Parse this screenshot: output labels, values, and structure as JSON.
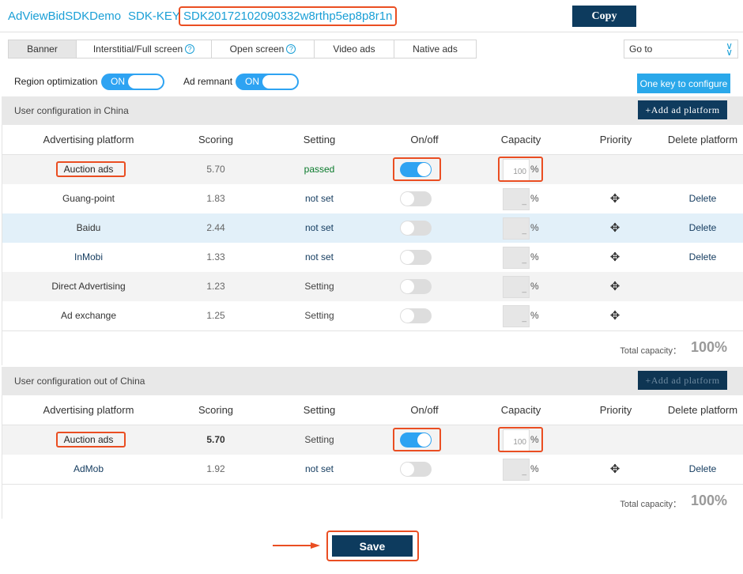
{
  "header": {
    "app_title": "AdViewBidSDKDemo",
    "sdk_key_label": "SDK-KEY",
    "sdk_key_value": "SDK20172102090332w8rthp5ep8p8r1n",
    "copy_label": "Copy"
  },
  "tabs": [
    {
      "label": "Banner",
      "active": true
    },
    {
      "label": "Interstitial/Full screen",
      "help": true
    },
    {
      "label": "Open screen",
      "help": true
    },
    {
      "label": "Video ads"
    },
    {
      "label": "Native ads"
    }
  ],
  "help_glyph": "?",
  "goto": {
    "label": "Go to",
    "icon": "double-chevron-down-icon"
  },
  "options": {
    "region_label": "Region optimization",
    "region_state": "ON",
    "remnant_label": "Ad remnant",
    "remnant_state": "ON",
    "one_key_label": "One key to configure"
  },
  "columns": [
    "Advertising platform",
    "Scoring",
    "Setting",
    "On/off",
    "Capacity",
    "Priority",
    "Delete platform"
  ],
  "china": {
    "title": "User configuration in China",
    "add_label": "+Add ad platform",
    "rows": [
      {
        "name": "Auction ads",
        "score": "5.70",
        "setting": "passed",
        "on": true,
        "capacity": "100",
        "priority": "",
        "delete": ""
      },
      {
        "name": "Guang-point",
        "score": "1.83",
        "setting": "not set",
        "on": false,
        "capacity": "_",
        "priority": "move",
        "delete": "Delete"
      },
      {
        "name": "Baidu",
        "score": "2.44",
        "setting": "not set",
        "on": false,
        "capacity": "_",
        "priority": "move",
        "delete": "Delete"
      },
      {
        "name": "InMobi",
        "score": "1.33",
        "setting": "not set",
        "on": false,
        "capacity": "_",
        "priority": "move",
        "delete": "Delete"
      },
      {
        "name": "Direct Advertising",
        "score": "1.23",
        "setting": "Setting",
        "on": false,
        "capacity": "_",
        "priority": "move",
        "delete": ""
      },
      {
        "name": "Ad exchange",
        "score": "1.25",
        "setting": "Setting",
        "on": false,
        "capacity": "_",
        "priority": "move",
        "delete": ""
      }
    ],
    "total_label": "Total capacity：",
    "total_value": "100%"
  },
  "abroad": {
    "title": "User configuration out of China",
    "add_label": "+Add ad platform",
    "rows": [
      {
        "name": "Auction ads",
        "score": "5.70",
        "setting": "Setting",
        "on": true,
        "capacity": "100",
        "priority": "",
        "delete": ""
      },
      {
        "name": "AdMob",
        "score": "1.92",
        "setting": "not set",
        "on": false,
        "capacity": "_",
        "priority": "move",
        "delete": "Delete"
      }
    ],
    "total_label": "Total capacity：",
    "total_value": "100%"
  },
  "percent_sign": "%",
  "save_label": "Save",
  "colors": {
    "accent": "#1a9fd6",
    "navy": "#0d3b5e",
    "highlight": "#ea4e22",
    "toggle_on": "#2ea3f2"
  }
}
